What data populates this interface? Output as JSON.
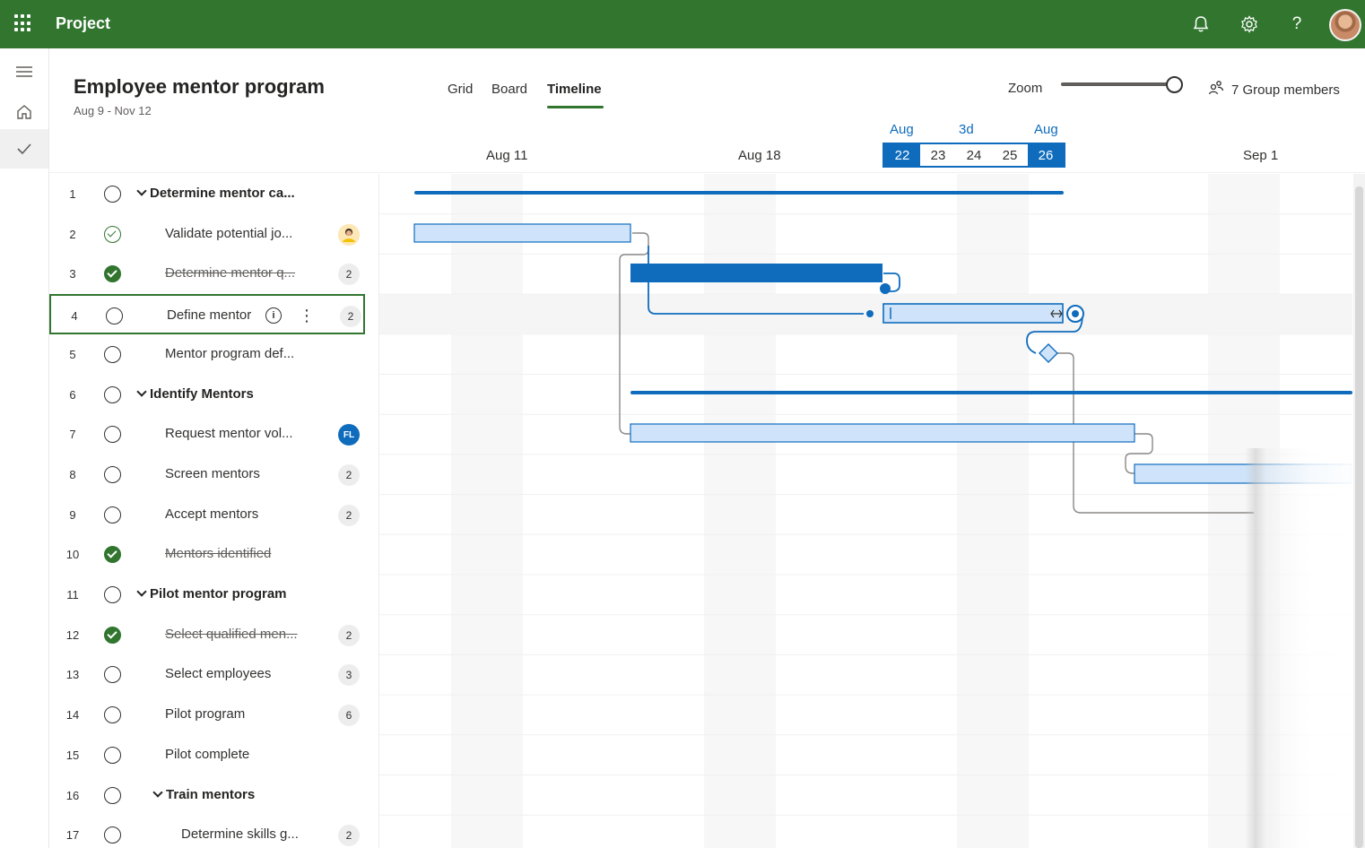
{
  "app": {
    "title": "Project"
  },
  "project": {
    "title": "Employee mentor program",
    "dates": "Aug 9 - Nov 12"
  },
  "views": [
    {
      "label": "Grid",
      "active": false
    },
    {
      "label": "Board",
      "active": false
    },
    {
      "label": "Timeline",
      "active": true
    }
  ],
  "zoom": {
    "label": "Zoom",
    "value_fraction": 1.0
  },
  "members": {
    "label": "7 Group members"
  },
  "timeline": {
    "weeks": [
      "Aug 11",
      "Aug 18",
      "Sep 1"
    ],
    "selection": {
      "start_month": "Aug",
      "duration": "3d",
      "end_month": "Aug",
      "days": [
        "22",
        "23",
        "24",
        "25",
        "26"
      ]
    }
  },
  "tasks": [
    {
      "num": "1",
      "name": "Determine mentor ca...",
      "status": "open",
      "summary": true,
      "indent": 0,
      "badge": ""
    },
    {
      "num": "2",
      "name": "Validate potential jo...",
      "status": "done-outline",
      "summary": false,
      "indent": 0,
      "badge": "person"
    },
    {
      "num": "3",
      "name": "Determine mentor q...",
      "status": "done",
      "summary": false,
      "indent": 0,
      "badge": "2"
    },
    {
      "num": "4",
      "name": "Define mentor",
      "status": "open",
      "summary": false,
      "indent": 0,
      "badge": "2",
      "selected": true
    },
    {
      "num": "5",
      "name": "Mentor program def...",
      "status": "open",
      "summary": false,
      "indent": 0,
      "badge": ""
    },
    {
      "num": "6",
      "name": "Identify Mentors",
      "status": "open",
      "summary": true,
      "indent": 0,
      "badge": ""
    },
    {
      "num": "7",
      "name": "Request mentor vol...",
      "status": "open",
      "summary": false,
      "indent": 0,
      "badge": "FL"
    },
    {
      "num": "8",
      "name": "Screen mentors",
      "status": "open",
      "summary": false,
      "indent": 0,
      "badge": "2"
    },
    {
      "num": "9",
      "name": "Accept mentors",
      "status": "open",
      "summary": false,
      "indent": 0,
      "badge": "2"
    },
    {
      "num": "10",
      "name": "Mentors identified",
      "status": "done",
      "summary": false,
      "indent": 0,
      "badge": ""
    },
    {
      "num": "11",
      "name": "Pilot mentor program",
      "status": "open",
      "summary": true,
      "indent": 0,
      "badge": ""
    },
    {
      "num": "12",
      "name": "Select qualified men...",
      "status": "done",
      "summary": false,
      "indent": 0,
      "badge": "2"
    },
    {
      "num": "13",
      "name": "Select employees",
      "status": "open",
      "summary": false,
      "indent": 0,
      "badge": "3"
    },
    {
      "num": "14",
      "name": "Pilot program",
      "status": "open",
      "summary": false,
      "indent": 0,
      "badge": "6"
    },
    {
      "num": "15",
      "name": "Pilot complete",
      "status": "open",
      "summary": false,
      "indent": 0,
      "badge": ""
    },
    {
      "num": "16",
      "name": "Train mentors",
      "status": "open",
      "summary": true,
      "indent": 1,
      "badge": ""
    },
    {
      "num": "17",
      "name": "Determine skills g...",
      "status": "open",
      "summary": false,
      "indent": 1,
      "badge": "2"
    }
  ],
  "colors": {
    "brand": "#31752f",
    "accent": "#0f6cbd",
    "bar_light": "#cfe4fa",
    "bar_dark": "#0f6cbd"
  },
  "icons": {
    "waffle": "waffle-icon",
    "bell": "bell-icon",
    "settings": "gear-icon",
    "help": "help-icon",
    "menu": "hamburger-icon",
    "home": "home-icon",
    "tasks": "checkmark-icon",
    "members": "people-icon",
    "info": "info-icon",
    "more": "more-vertical-icon"
  }
}
